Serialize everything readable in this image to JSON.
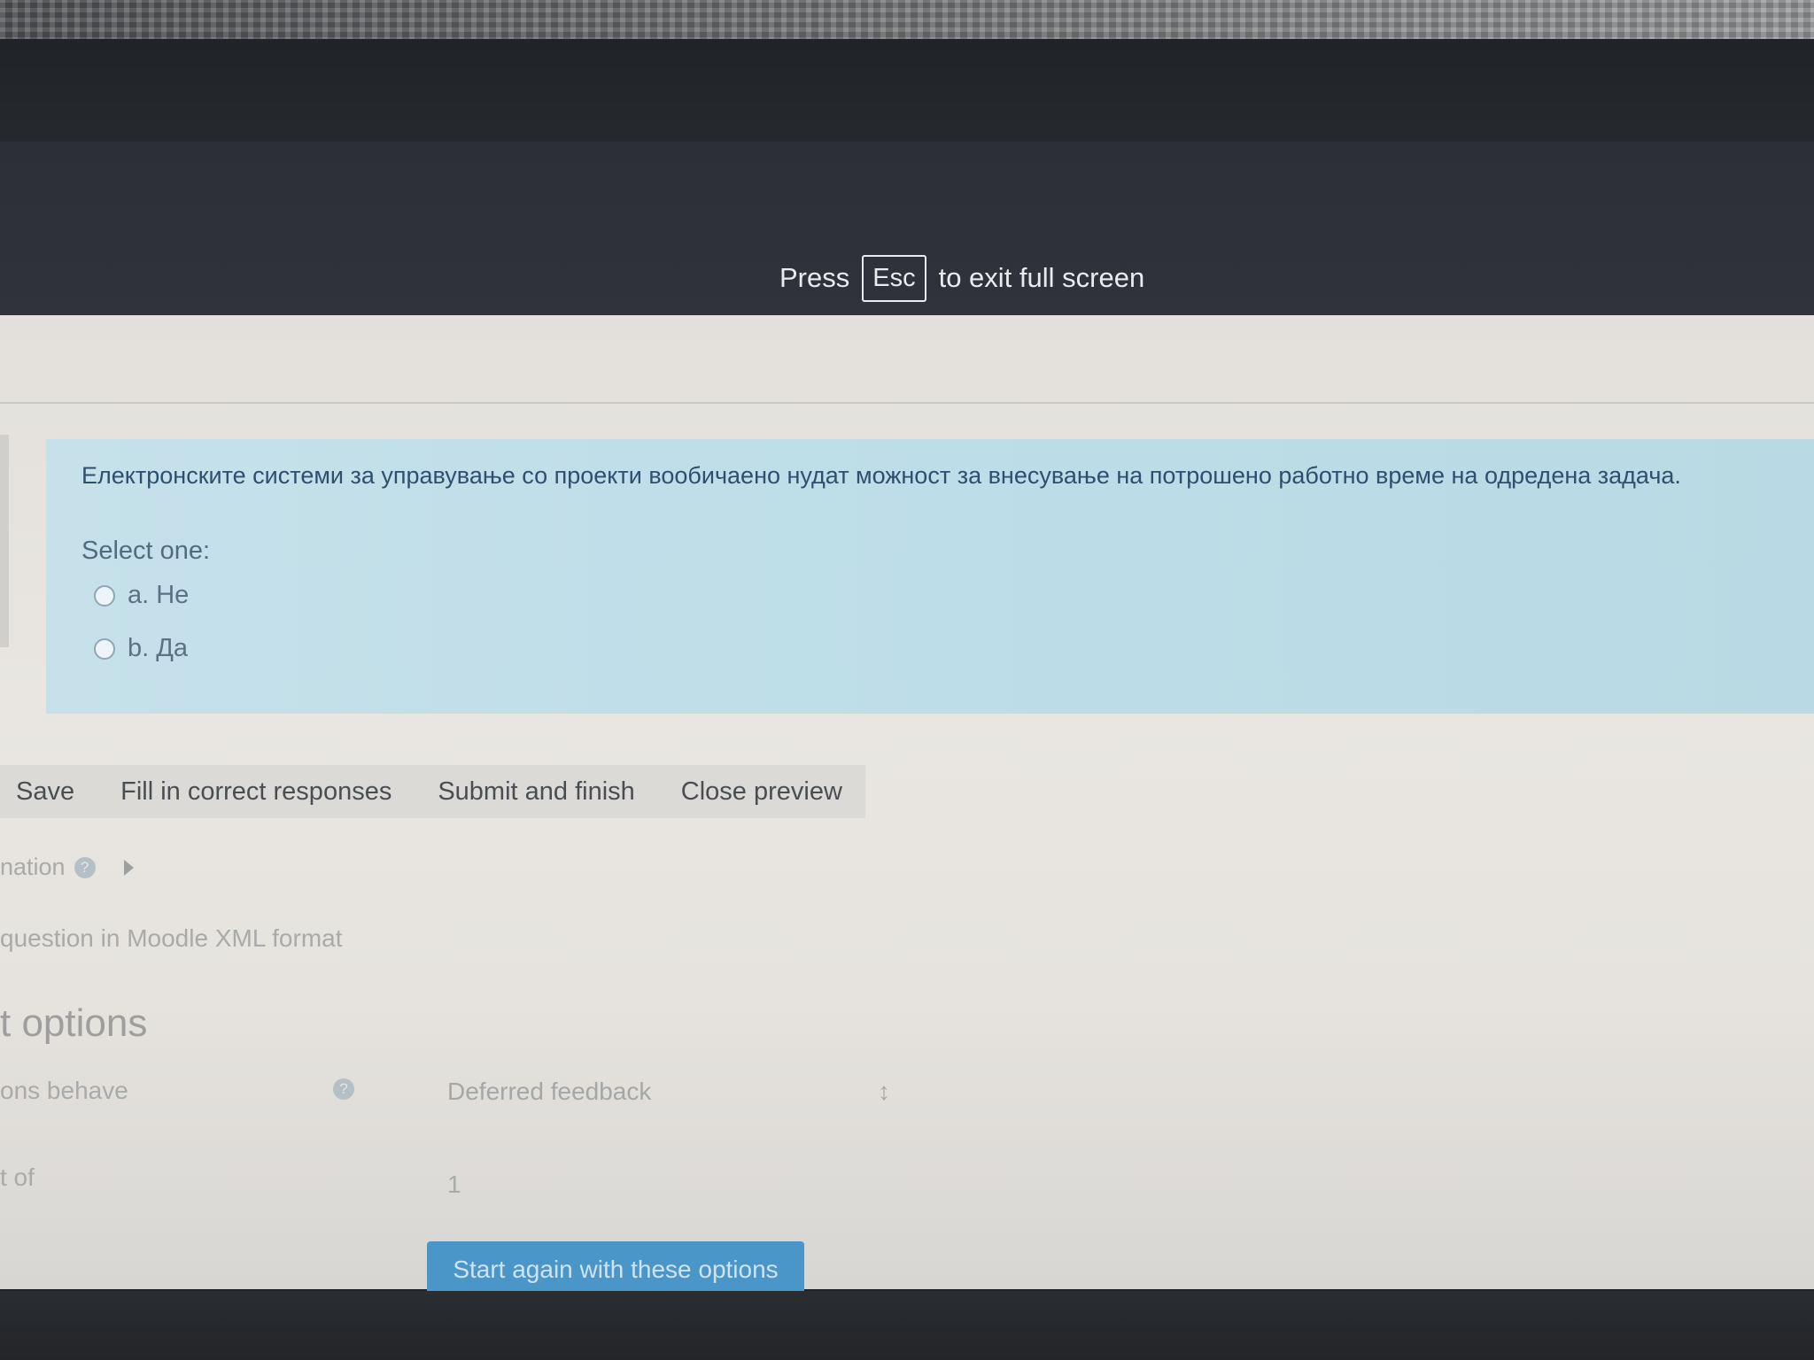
{
  "fullscreen_notice": {
    "press": "Press",
    "key": "Esc",
    "message": "to exit full screen"
  },
  "question": {
    "text": "Електронските системи за управување со проекти вообичаено нудат можност за внесување на потрошено работно време на одредена задача.",
    "prompt": "Select one:",
    "options": [
      {
        "label": "a. Не",
        "selected": false
      },
      {
        "label": "b. Да",
        "selected": false
      }
    ]
  },
  "actions": {
    "save": "Save",
    "fill": "Fill in correct responses",
    "submit": "Submit and finish",
    "close": "Close preview"
  },
  "info": {
    "information": "nation",
    "export": "question in Moodle XML format"
  },
  "options_section": {
    "heading": "t options",
    "behave_label": "ons behave",
    "behave_value": "Deferred feedback",
    "mark_label": "t of",
    "mark_value": "1",
    "start_again": "Start again with these options"
  },
  "colors": {
    "question_bg": "#c6e1ea",
    "button_primary": "#4a96c9",
    "notice_bg": "#2c3036"
  },
  "icons": {
    "help": "help-icon",
    "expand": "triangle-right-icon",
    "select": "select-arrows-icon"
  }
}
